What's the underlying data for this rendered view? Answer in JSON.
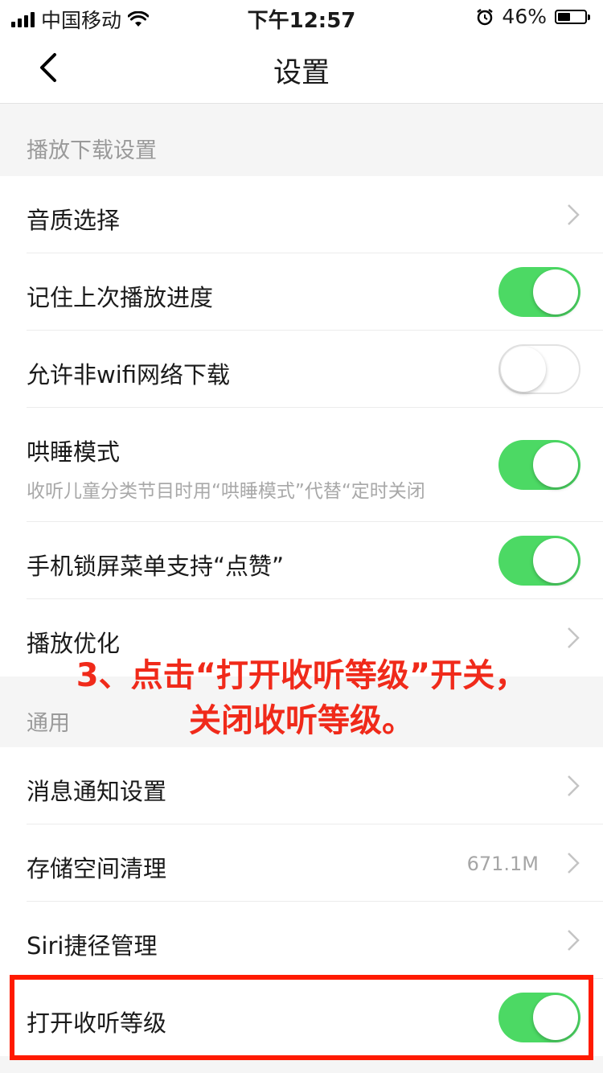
{
  "status_bar": {
    "carrier": "中国移动",
    "time": "下午12:57",
    "battery": "46%",
    "battery_level": 0.46
  },
  "nav": {
    "title": "设置"
  },
  "sections": [
    {
      "header": "播放下载设置",
      "rows": [
        {
          "label": "音质选择",
          "type": "chevron"
        },
        {
          "label": "记住上次播放进度",
          "type": "toggle",
          "on": true
        },
        {
          "label": "允许非wifi网络下载",
          "type": "toggle",
          "on": false
        },
        {
          "label": "哄睡模式",
          "subtitle": "收听儿童分类节目时用“哄睡模式”代替“定时关闭",
          "type": "toggle",
          "on": true
        },
        {
          "label": "手机锁屏菜单支持“点赞”",
          "type": "toggle",
          "on": true
        },
        {
          "label": "播放优化",
          "type": "chevron"
        }
      ]
    },
    {
      "header": "通用",
      "rows": [
        {
          "label": "消息通知设置",
          "type": "chevron"
        },
        {
          "label": "存储空间清理",
          "value": "671.1M",
          "type": "chevron"
        },
        {
          "label": "Siri捷径管理",
          "type": "chevron"
        },
        {
          "label": "打开收听等级",
          "type": "toggle",
          "on": true
        }
      ]
    }
  ],
  "annotation": {
    "line1": "3、点击“打开收听等级”开关，",
    "line2": "关闭收听等级。"
  },
  "colors": {
    "toggle_on": "#4cd964",
    "annotation": "#f02a1a",
    "highlight_border": "#ff1a00"
  }
}
